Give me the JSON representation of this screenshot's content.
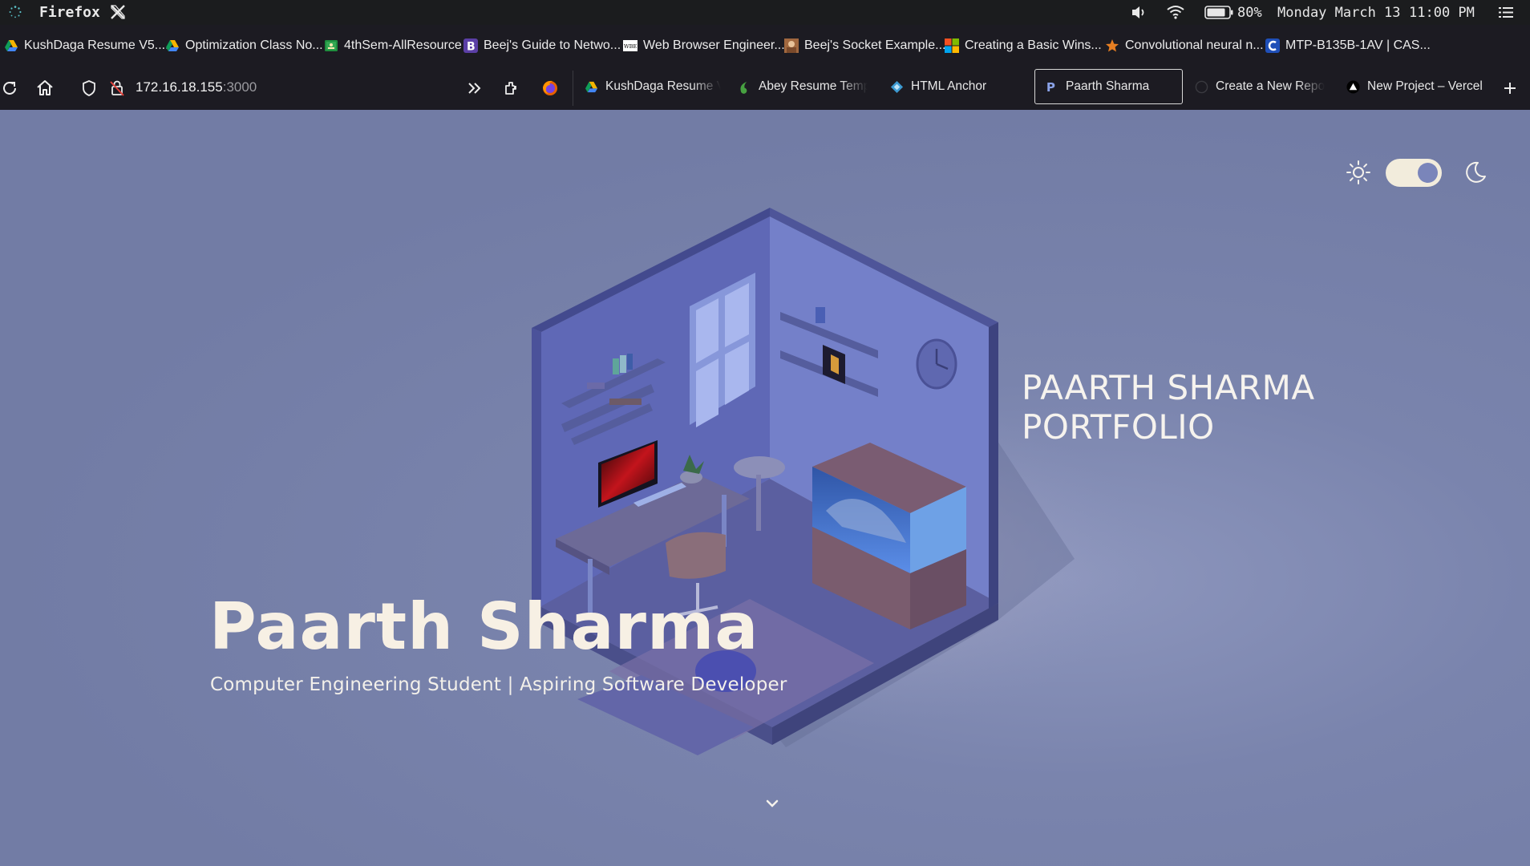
{
  "os": {
    "app_name": "Firefox",
    "battery_pct": "80%",
    "date": "Monday March 13",
    "time": "11:00 PM",
    "icons": [
      "loading-spinner-icon",
      "x-logo-icon",
      "speaker-icon",
      "wifi-icon",
      "battery-icon",
      "menu-icon"
    ]
  },
  "bookmarks": [
    {
      "label": "KushDaga Resume V5....",
      "icon": "google-drive-icon"
    },
    {
      "label": "Optimization Class No...",
      "icon": "google-drive-icon"
    },
    {
      "label": "4thSem-AllResource",
      "icon": "google-classroom-icon"
    },
    {
      "label": "Beej's Guide to Netwo...",
      "icon": "bootstrap-b-icon"
    },
    {
      "label": "Web Browser Engineer...",
      "icon": "wbe-icon"
    },
    {
      "label": "Beej's Socket Example...",
      "icon": "image-favicon-icon"
    },
    {
      "label": "Creating a Basic Wins...",
      "icon": "microsoft-icon"
    },
    {
      "label": "Convolutional neural n...",
      "icon": "star-icon"
    },
    {
      "label": "MTP-B135B-1AV | CAS...",
      "icon": "casio-icon"
    }
  ],
  "toolbar": {
    "url_host": "172.16.18.155",
    "url_port": ":3000"
  },
  "tabs": [
    {
      "label": "KushDaga Resume V",
      "icon": "google-drive-icon"
    },
    {
      "label": "Abey Resume Templ",
      "icon": "overleaf-icon"
    },
    {
      "label": "HTML Anchor",
      "icon": "diamond-icon"
    },
    {
      "label": "Paarth Sharma",
      "icon": "p-favicon-icon",
      "active": true
    },
    {
      "label": "Create a New Repos",
      "icon": "github-icon"
    },
    {
      "label": "New Project – Vercel",
      "icon": "vercel-icon"
    }
  ],
  "page": {
    "portfolio_line1": "PAARTH SHARMA",
    "portfolio_line2": "PORTFOLIO",
    "name": "Paarth Sharma",
    "subtitle": "Computer Engineering Student | Aspiring Software Developer",
    "theme_toggle_on": true
  }
}
